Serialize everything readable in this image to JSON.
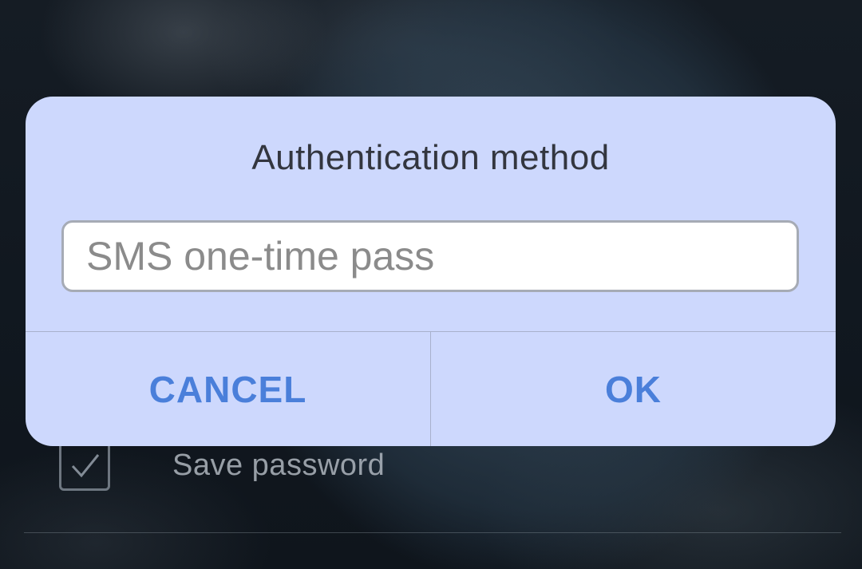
{
  "background": {
    "save_password_label": "Save password",
    "save_password_checked": true
  },
  "dialog": {
    "title": "Authentication method",
    "input_placeholder": "SMS one-time pass",
    "input_value": "",
    "cancel_label": "CANCEL",
    "ok_label": "OK"
  },
  "colors": {
    "dialog_bg": "#cdd8fd",
    "button_accent": "#4a7fda",
    "title_text": "#33363f"
  }
}
